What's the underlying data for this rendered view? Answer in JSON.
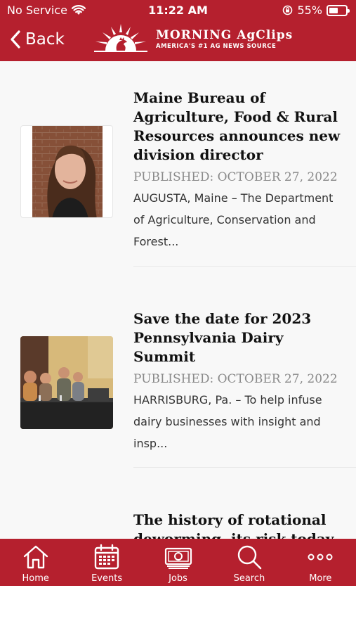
{
  "status_bar": {
    "carrier": "No Service",
    "time": "11:22 AM",
    "battery": "55%",
    "battery_level": 0.55
  },
  "nav": {
    "back_label": "Back",
    "logo_line1": "MORNING AgClips",
    "logo_line2": "AMERICA'S #1 AG NEWS SOURCE"
  },
  "articles": [
    {
      "title": "Maine Bureau of Agriculture, Food & Rural Resources announces new division director",
      "published": "PUBLISHED: OCTOBER 27, 2022",
      "excerpt": "AUGUSTA, Maine – The Department of Agriculture, Conservation and Forest..."
    },
    {
      "title": "Save the date for 2023 Pennsylvania Dairy Summit",
      "published": "PUBLISHED: OCTOBER 27, 2022",
      "excerpt": "HARRISBURG, Pa. – To help infuse dairy businesses with insight and insp..."
    },
    {
      "title": "The history of rotational deworming, its risk today",
      "published": "",
      "excerpt": ""
    }
  ],
  "tabbar": {
    "items": [
      {
        "label": "Home",
        "icon": "home-icon"
      },
      {
        "label": "Events",
        "icon": "calendar-icon"
      },
      {
        "label": "Jobs",
        "icon": "money-icon"
      },
      {
        "label": "Search",
        "icon": "search-icon"
      },
      {
        "label": "More",
        "icon": "more-icon"
      }
    ]
  },
  "colors": {
    "brand_red": "#b5202e",
    "list_background": "#f8f8f8",
    "date_gray": "#8a8a8a"
  }
}
